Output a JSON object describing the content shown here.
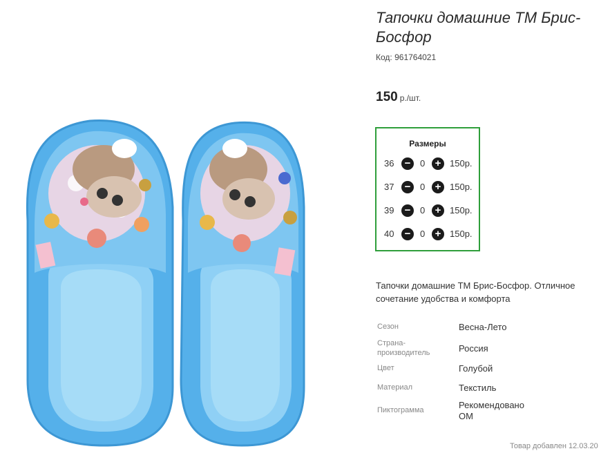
{
  "product": {
    "title": "Тапочки домашние ТМ Брис-Босфор",
    "code_label": "Код:",
    "code": "961764021",
    "price": "150",
    "price_unit": "р./шт.",
    "description": "Тапочки домашние ТМ Брис-Босфор. Отличное сочетание удобства и комфорта",
    "added": "Товар добавлен 12.03.20"
  },
  "sizes": {
    "title": "Размеры",
    "rows": [
      {
        "size": "36",
        "qty": "0",
        "price": "150р."
      },
      {
        "size": "37",
        "qty": "0",
        "price": "150р."
      },
      {
        "size": "39",
        "qty": "0",
        "price": "150р."
      },
      {
        "size": "40",
        "qty": "0",
        "price": "150р."
      }
    ]
  },
  "properties": [
    {
      "key": "Сезон",
      "value": "Весна-Лето"
    },
    {
      "key": "Страна-производитель",
      "value": "Россия"
    },
    {
      "key": "Цвет",
      "value": "Голубой"
    },
    {
      "key": "Материал",
      "value": "Текстиль"
    },
    {
      "key": "Пиктограмма",
      "value": "Рекомендовано ОМ"
    }
  ],
  "icons": {
    "minus": "minus-circle-icon",
    "plus": "plus-circle-icon"
  },
  "colors": {
    "sizes_border": "#2e9e3a",
    "slipper_blue": "#5eb4ea"
  }
}
